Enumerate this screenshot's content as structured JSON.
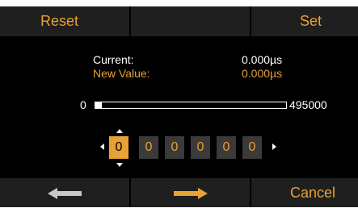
{
  "top_bar": {
    "reset_label": "Reset",
    "set_label": "Set"
  },
  "readout": {
    "current_label": "Current:",
    "current_value": "0.000µs",
    "new_value_label": "New Value:",
    "new_value": "0.000µs"
  },
  "slider": {
    "min_label": "0",
    "max_label": "495000",
    "fraction": 0.0
  },
  "digits": [
    "0",
    "0",
    "0",
    "0",
    "0",
    "0"
  ],
  "selected_digit_index": 0,
  "bottom_bar": {
    "back_icon": "arrow-left-icon",
    "forward_icon": "arrow-right-icon",
    "cancel_label": "Cancel"
  },
  "colors": {
    "accent": "#e8a134",
    "panel": "#1f1f1f",
    "background": "#000000",
    "digit_bg": "#3a3a3a"
  }
}
